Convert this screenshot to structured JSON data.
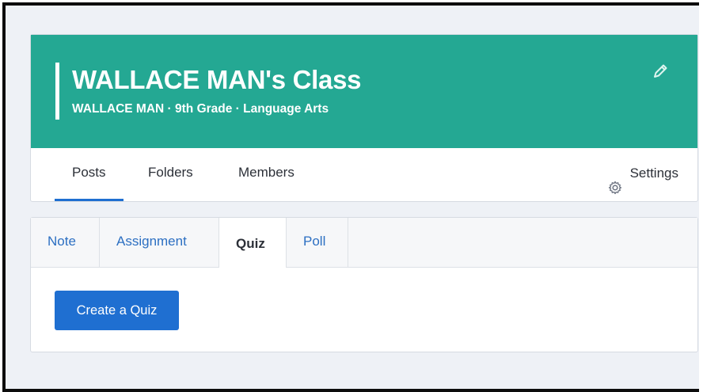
{
  "class_header": {
    "title": "WALLACE MAN's Class",
    "subtitle": "WALLACE MAN · 9th Grade · Language Arts",
    "banner_color": "#24a893",
    "edit_icon": "pencil-icon"
  },
  "class_nav": {
    "tabs": [
      {
        "label": "Posts",
        "active": true
      },
      {
        "label": "Folders",
        "active": false
      },
      {
        "label": "Members",
        "active": false
      }
    ],
    "settings_label": "Settings",
    "settings_icon": "gear-icon",
    "active_color": "#1f6fd1"
  },
  "composer": {
    "tabs": [
      {
        "label": "Note",
        "active": false
      },
      {
        "label": "Assignment",
        "active": false
      },
      {
        "label": "Quiz",
        "active": true
      },
      {
        "label": "Poll",
        "active": false
      }
    ],
    "create_button_label": "Create a Quiz",
    "button_color": "#1f6fd1"
  }
}
